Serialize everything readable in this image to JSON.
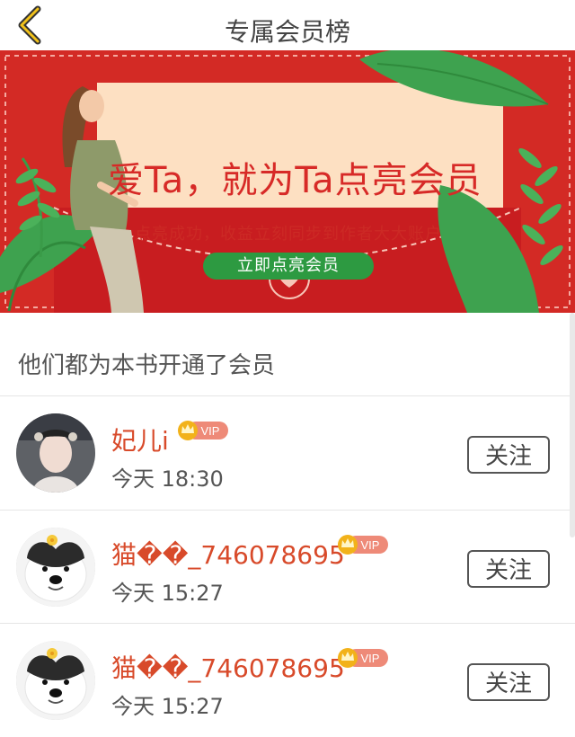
{
  "header": {
    "title": "专属会员榜"
  },
  "banner": {
    "headline": "爱Ta，就为Ta点亮会员",
    "subline": "点亮成功，收益立刻同步到作者大大账户",
    "cta_label": "立即点亮会员"
  },
  "section_title": "他们都为本书开通了会员",
  "members": [
    {
      "name": "妃儿i",
      "badge": "VIP",
      "time": "今天 18:30",
      "follow_label": "关注"
    },
    {
      "name": "猫��_746078695",
      "badge": "VIP",
      "time": "今天 15:27",
      "follow_label": "关注"
    },
    {
      "name": "猫��_746078695",
      "badge": "VIP",
      "time": "今天 15:27",
      "follow_label": "关注"
    }
  ],
  "colors": {
    "banner_red": "#d32a25",
    "accent_green": "#2d9a41",
    "name_orange": "#d84a2a",
    "vip_gold": "#f2b21a"
  }
}
